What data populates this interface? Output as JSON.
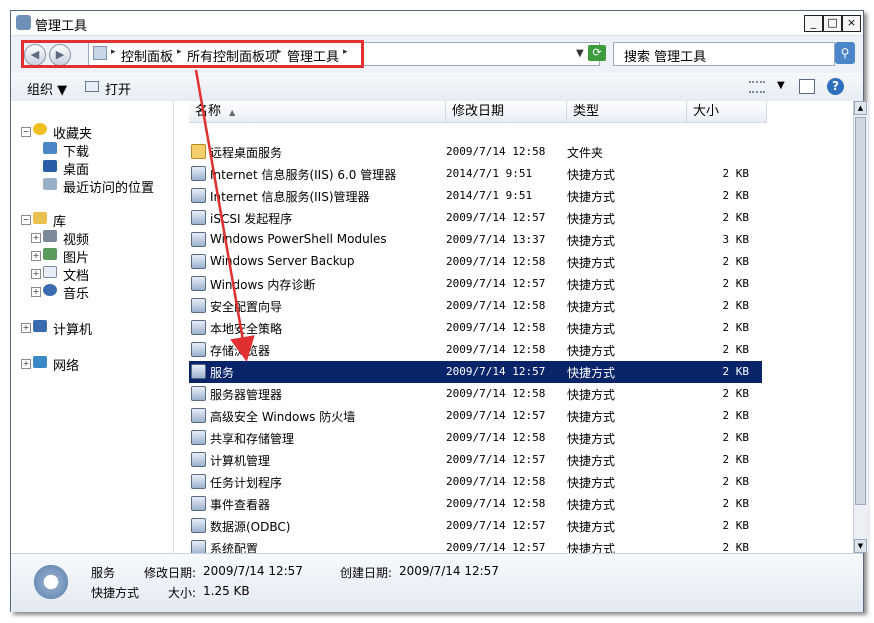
{
  "window": {
    "title": "管理工具",
    "min_label": "_",
    "max_label": "□",
    "close_label": "×"
  },
  "address": {
    "back_label": "◀",
    "forward_label": "▶",
    "crumbs": [
      "控制面板",
      "所有控制面板项",
      "管理工具"
    ],
    "sep": "▸",
    "search_placeholder": "搜索 管理工具"
  },
  "toolbar": {
    "organize": "组织 ▼",
    "open": "打开"
  },
  "nav": {
    "favorites": "收藏夹",
    "downloads": "下载",
    "desktop": "桌面",
    "recent": "最近访问的位置",
    "libraries": "库",
    "videos": "视频",
    "pictures": "图片",
    "documents": "文档",
    "music": "音乐",
    "computer": "计算机",
    "network": "网络"
  },
  "columns": {
    "name": "名称",
    "modified": "修改日期",
    "type": "类型",
    "size": "大小"
  },
  "files": [
    {
      "name": "远程桌面服务",
      "date": "2009/7/14 12:58",
      "type": "文件夹",
      "size": ""
    },
    {
      "name": "Internet 信息服务(IIS) 6.0 管理器",
      "date": "2014/7/1 9:51",
      "type": "快捷方式",
      "size": "2 KB"
    },
    {
      "name": "Internet 信息服务(IIS)管理器",
      "date": "2014/7/1 9:51",
      "type": "快捷方式",
      "size": "2 KB"
    },
    {
      "name": "iSCSI 发起程序",
      "date": "2009/7/14 12:57",
      "type": "快捷方式",
      "size": "2 KB"
    },
    {
      "name": "Windows PowerShell Modules",
      "date": "2009/7/14 13:37",
      "type": "快捷方式",
      "size": "3 KB"
    },
    {
      "name": "Windows Server Backup",
      "date": "2009/7/14 12:58",
      "type": "快捷方式",
      "size": "2 KB"
    },
    {
      "name": "Windows 内存诊断",
      "date": "2009/7/14 12:57",
      "type": "快捷方式",
      "size": "2 KB"
    },
    {
      "name": "安全配置向导",
      "date": "2009/7/14 12:58",
      "type": "快捷方式",
      "size": "2 KB"
    },
    {
      "name": "本地安全策略",
      "date": "2009/7/14 12:58",
      "type": "快捷方式",
      "size": "2 KB"
    },
    {
      "name": "存储浏览器",
      "date": "2009/7/14 12:58",
      "type": "快捷方式",
      "size": "2 KB"
    },
    {
      "name": "服务",
      "date": "2009/7/14 12:57",
      "type": "快捷方式",
      "size": "2 KB"
    },
    {
      "name": "服务器管理器",
      "date": "2009/7/14 12:58",
      "type": "快捷方式",
      "size": "2 KB"
    },
    {
      "name": "高级安全 Windows 防火墙",
      "date": "2009/7/14 12:57",
      "type": "快捷方式",
      "size": "2 KB"
    },
    {
      "name": "共享和存储管理",
      "date": "2009/7/14 12:58",
      "type": "快捷方式",
      "size": "2 KB"
    },
    {
      "name": "计算机管理",
      "date": "2009/7/14 12:57",
      "type": "快捷方式",
      "size": "2 KB"
    },
    {
      "name": "任务计划程序",
      "date": "2009/7/14 12:58",
      "type": "快捷方式",
      "size": "2 KB"
    },
    {
      "name": "事件查看器",
      "date": "2009/7/14 12:58",
      "type": "快捷方式",
      "size": "2 KB"
    },
    {
      "name": "数据源(ODBC)",
      "date": "2009/7/14 12:57",
      "type": "快捷方式",
      "size": "2 KB"
    },
    {
      "name": "系统配置",
      "date": "2009/7/14 12:57",
      "type": "快捷方式",
      "size": "2 KB"
    }
  ],
  "selected_index": 10,
  "details": {
    "name": "服务",
    "modified_label": "修改日期:",
    "modified_value": "2009/7/14 12:57",
    "created_label": "创建日期:",
    "created_value": "2009/7/14 12:57",
    "type": "快捷方式",
    "size_label": "大小:",
    "size_value": "1.25 KB"
  },
  "colors": {
    "selection": "#0a246a",
    "annotation": "#e03030"
  }
}
